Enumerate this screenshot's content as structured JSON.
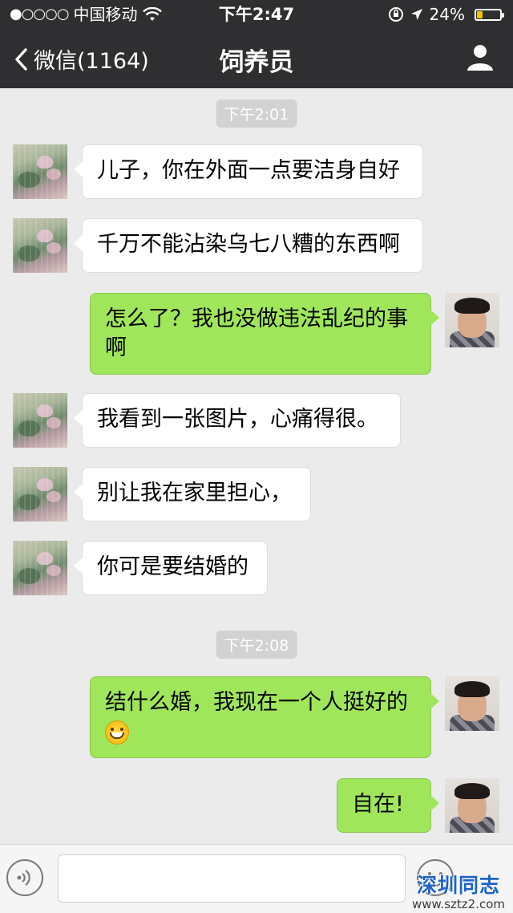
{
  "status_bar": {
    "signal_dots": "●○○○○",
    "carrier": "中国移动",
    "time": "下午2:47",
    "battery_percent": "24%",
    "battery_level": 0.24,
    "battery_color": "#f5c400"
  },
  "nav": {
    "back_label": "微信(1164)",
    "title": "饲养员",
    "profile_icon": "person-icon"
  },
  "timestamps": [
    "下午2:01",
    "下午2:08"
  ],
  "messages": [
    {
      "from": "them",
      "text": "儿子，你在外面一点要洁身自好"
    },
    {
      "from": "them",
      "text": "千万不能沾染乌七八糟的东西啊"
    },
    {
      "from": "me",
      "text": "怎么了？我也没做违法乱纪的事啊"
    },
    {
      "from": "them",
      "text": "我看到一张图片，心痛得很。"
    },
    {
      "from": "them",
      "text": "别让我在家里担心，"
    },
    {
      "from": "them",
      "text": "你可是要结婚的"
    },
    {
      "from": "me",
      "text": "结什么婚，我现在一个人挺好的",
      "emoji": "grin-emoji"
    },
    {
      "from": "me",
      "text": "自在!"
    }
  ],
  "input_bar": {
    "voice_icon": "voice-icon",
    "emoji_icon": "emoji-icon",
    "placeholder": ""
  },
  "watermark": {
    "top": "深圳同志",
    "bottom": "www.sztz2.com"
  },
  "colors": {
    "header_bg": "#2f2f31",
    "chat_bg": "#ebebeb",
    "bubble_in": "#ffffff",
    "bubble_out": "#9fe65a"
  }
}
